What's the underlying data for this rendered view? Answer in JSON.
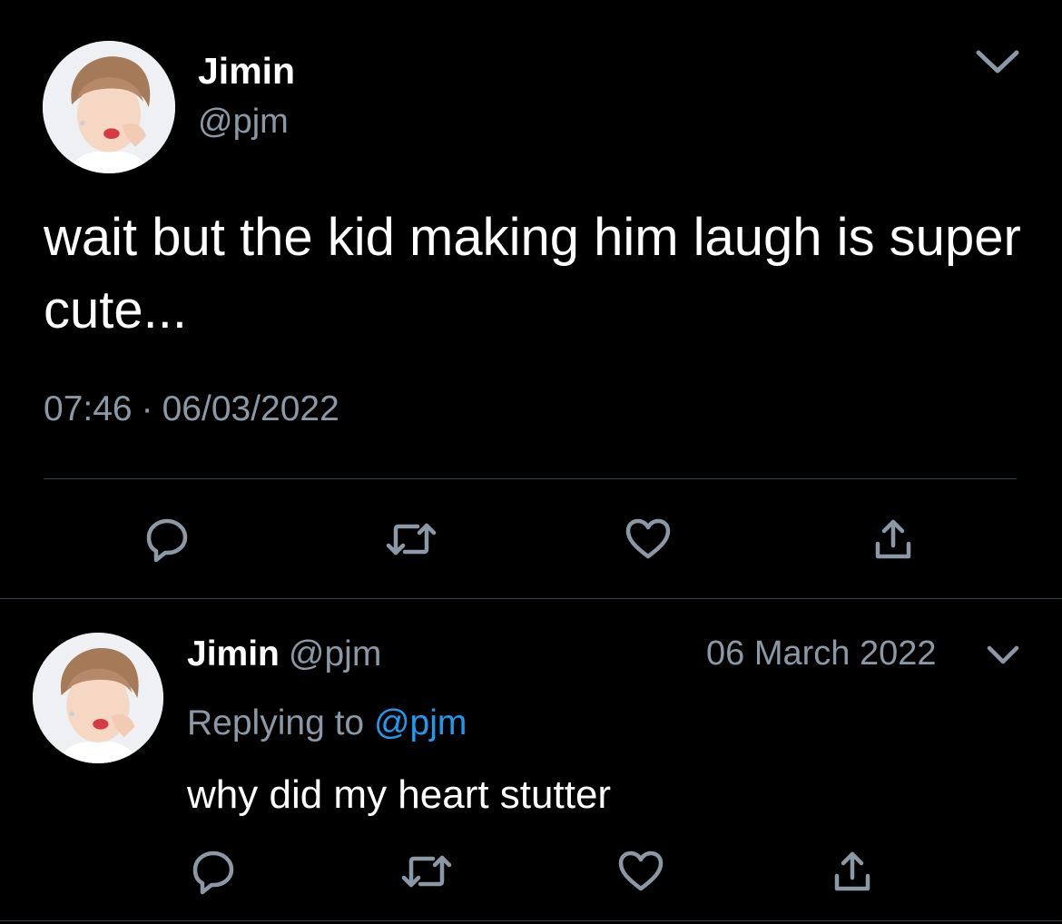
{
  "main_tweet": {
    "author_name": "Jimin",
    "author_handle": "@pjm",
    "text": "wait but the kid making him laugh is super cute...",
    "time": "07:46",
    "separator": "·",
    "date": "06/03/2022",
    "actions": [
      "reply-icon",
      "retweet-icon",
      "like-icon",
      "share-icon"
    ]
  },
  "reply_tweet": {
    "author_name": "Jimin",
    "author_handle": "@pjm",
    "date": "06 March 2022",
    "replying_prefix": "Replying to",
    "replying_mention": "@pjm",
    "text": "why did my heart stutter",
    "actions": [
      "reply-icon",
      "retweet-icon",
      "like-icon",
      "share-icon"
    ]
  },
  "colors": {
    "background": "#000000",
    "primary_text": "#ffffff",
    "secondary_text": "#8b98a5",
    "divider": "#38444d",
    "mention": "#1d9bf0"
  }
}
